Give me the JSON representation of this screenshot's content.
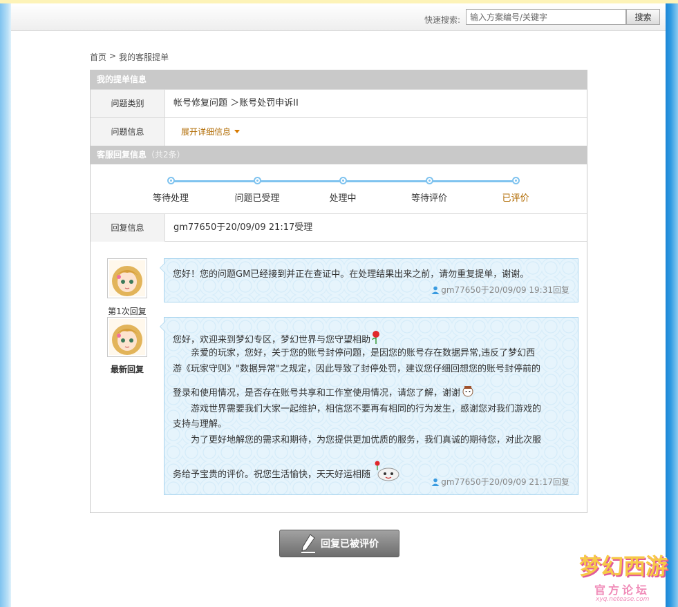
{
  "header": {
    "search_label": "快速搜索:",
    "search_placeholder": "输入方案编号/关键字",
    "search_button": "搜索"
  },
  "breadcrumb": {
    "home": "首页",
    "separator": ">",
    "current": "我的客服提单"
  },
  "ticket_info": {
    "section_title": "我的提单信息",
    "category_label": "问题类别",
    "category_value": "帐号修复问题 ＞账号处罚申诉II",
    "info_label": "问题信息",
    "expand_link": "展开详细信息"
  },
  "reply_info": {
    "section_title": "客服回复信息",
    "count": "（共2条）",
    "steps": [
      "等待处理",
      "问题已受理",
      "处理中",
      "等待评价",
      "已评价"
    ],
    "active_step": 4,
    "reply_label": "回复信息",
    "reply_value": "gm77650于20/09/09 21:17受理"
  },
  "messages": [
    {
      "avatar_label": "第1次回复",
      "text": "您好！您的问题GM已经接到并正在查证中。在处理结果出来之前，请勿重复提单，谢谢。",
      "meta": "gm77650于20/09/09 19:31回复"
    },
    {
      "avatar_label": "最新回复",
      "lines": [
        "您好，欢迎来到梦幻专区，梦幻世界与您守望相助",
        "　　亲爱的玩家，您好，关于您的账号封停问题，是因您的账号存在数据异常,违反了梦幻西",
        "游《玩家守则》\"数据异常\"之规定，因此导致了封停处罚，建议您仔细回想您的账号封停前的",
        "登录和使用情况，是否存在账号共享和工作室使用情况，请您了解，谢谢",
        "　　游戏世界需要我们大家一起维护，相信您不要再有相同的行为发生，感谢您对我们游戏的",
        "支持与理解。",
        "　　为了更好地解您的需求和期待，为您提供更加优质的服务，我们真诚的期待您，对此次服",
        "务给予宝贵的评价。祝您生活愉快，天天好运相随"
      ],
      "meta": "gm77650于20/09/09 21:17回复"
    }
  ],
  "reply_button": "回复已被评价",
  "watermark": {
    "title": "梦幻西游",
    "subtitle": "官方论坛",
    "url": "xyq.netease.com"
  },
  "colors": {
    "accent": "#7fc3ef",
    "section_header": "#c9c9c9",
    "link": "#b06a00",
    "bubble_bg": "#e6f4fc"
  }
}
